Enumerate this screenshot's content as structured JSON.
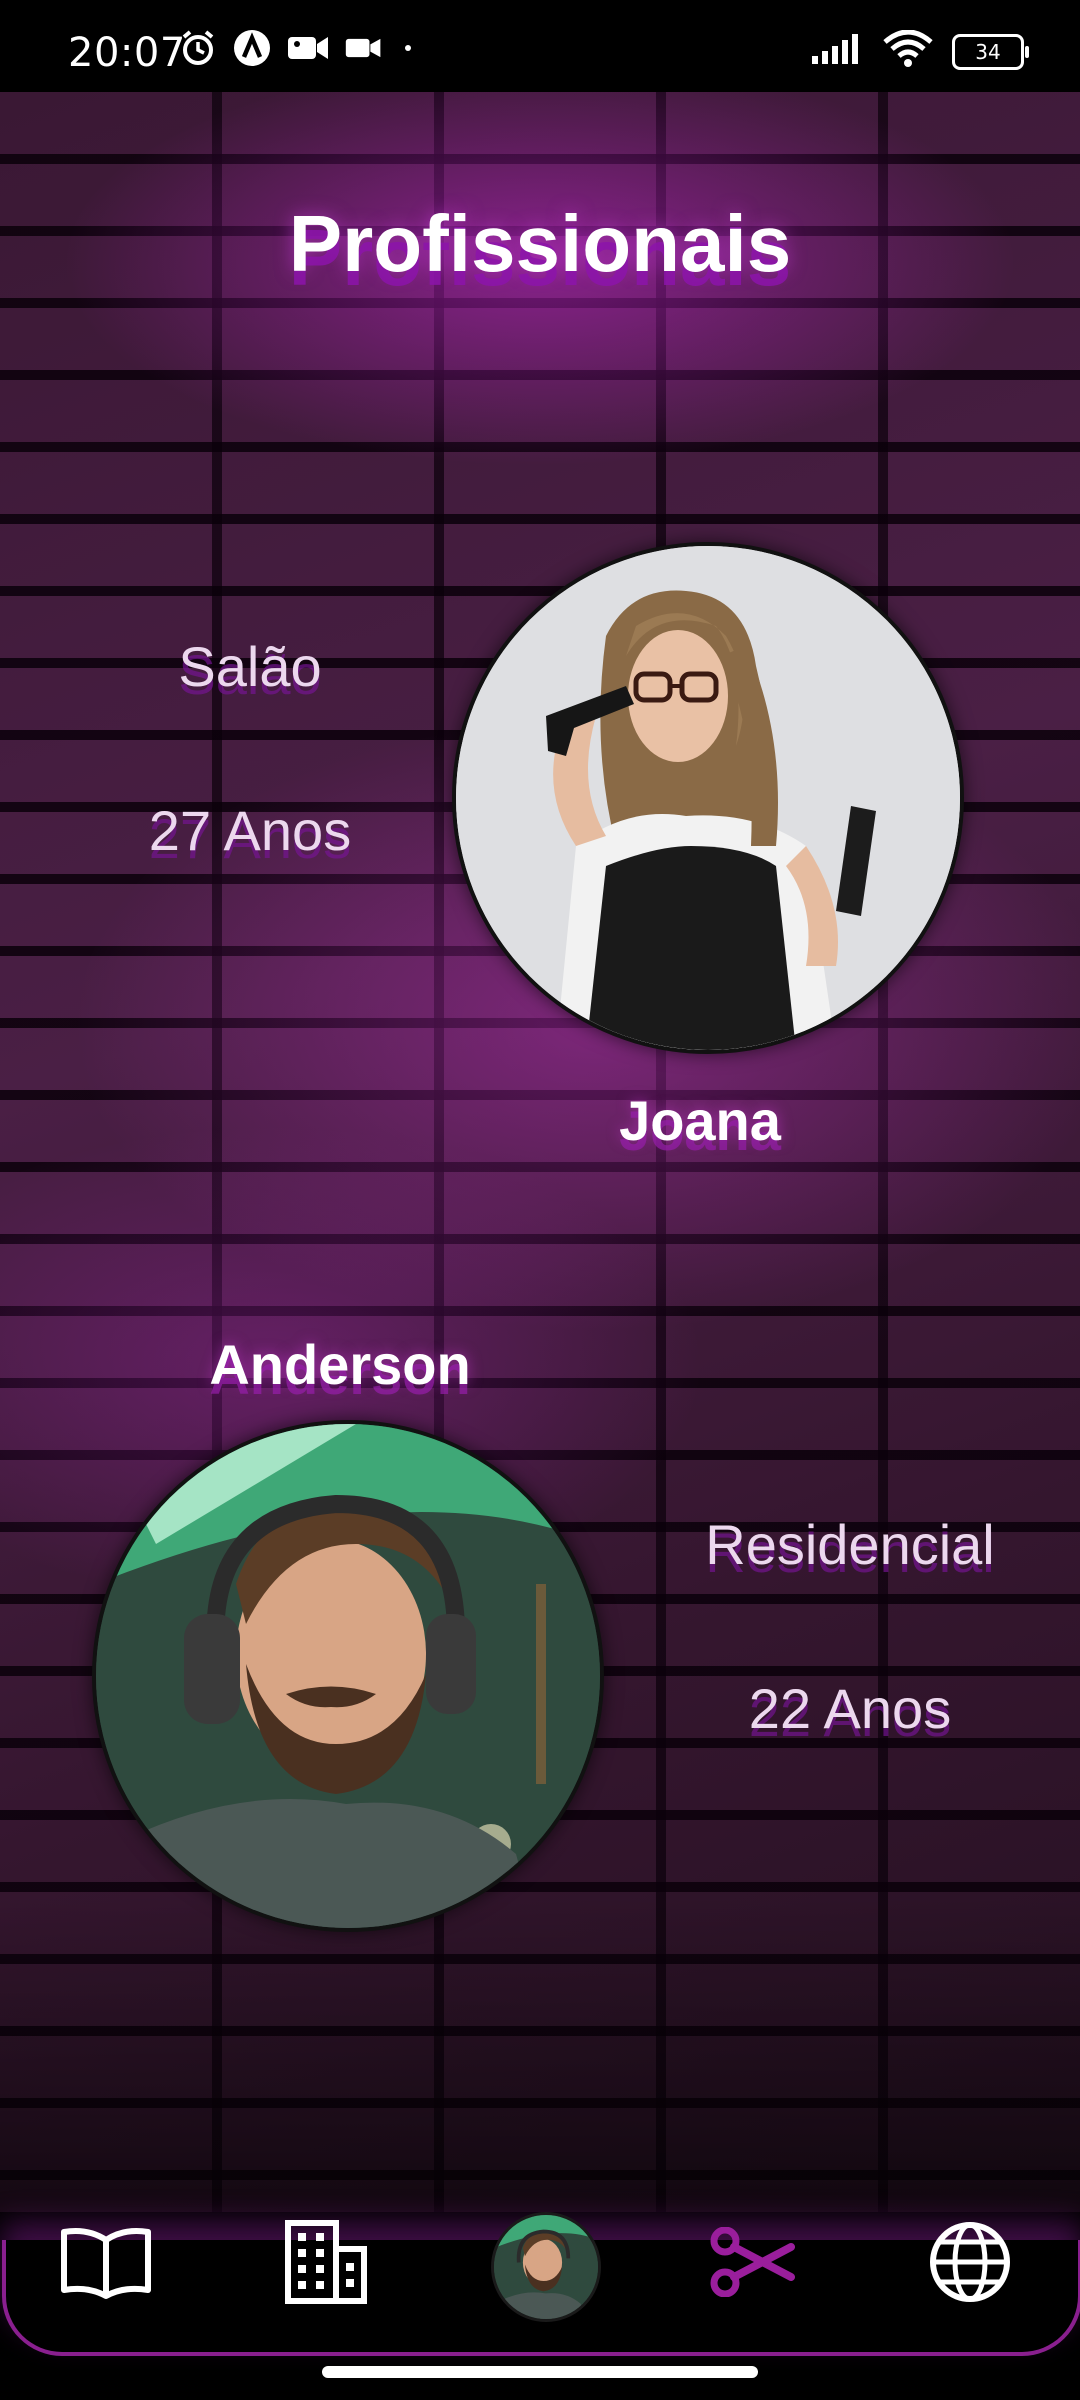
{
  "status_bar": {
    "time": "20:07",
    "battery": "34",
    "icons_left": [
      "alarm-icon",
      "a-badge-icon",
      "video-camera-icon",
      "video-camera-icon",
      "dot-icon"
    ],
    "icons_right": [
      "signal-icon",
      "wifi-icon",
      "battery-icon"
    ]
  },
  "page": {
    "title": "Profissionais"
  },
  "professionals": [
    {
      "name": "Joana",
      "place": "Salão",
      "age": "27 Anos",
      "photo": "portrait-woman-with-toy-gun-and-clipper"
    },
    {
      "name": "Anderson",
      "place": "Residencial",
      "age": "22 Anos",
      "photo": "portrait-bearded-man-with-headphones"
    }
  ],
  "bottom_nav": {
    "items": [
      "book-icon",
      "building-icon",
      "profile-avatar",
      "scissors-icon",
      "globe-icon"
    ],
    "active": "scissors-icon"
  },
  "colors": {
    "accent": "#8a1f8f",
    "active_icon": "#9a1e9c",
    "neon_glow": "#c23ad6"
  }
}
